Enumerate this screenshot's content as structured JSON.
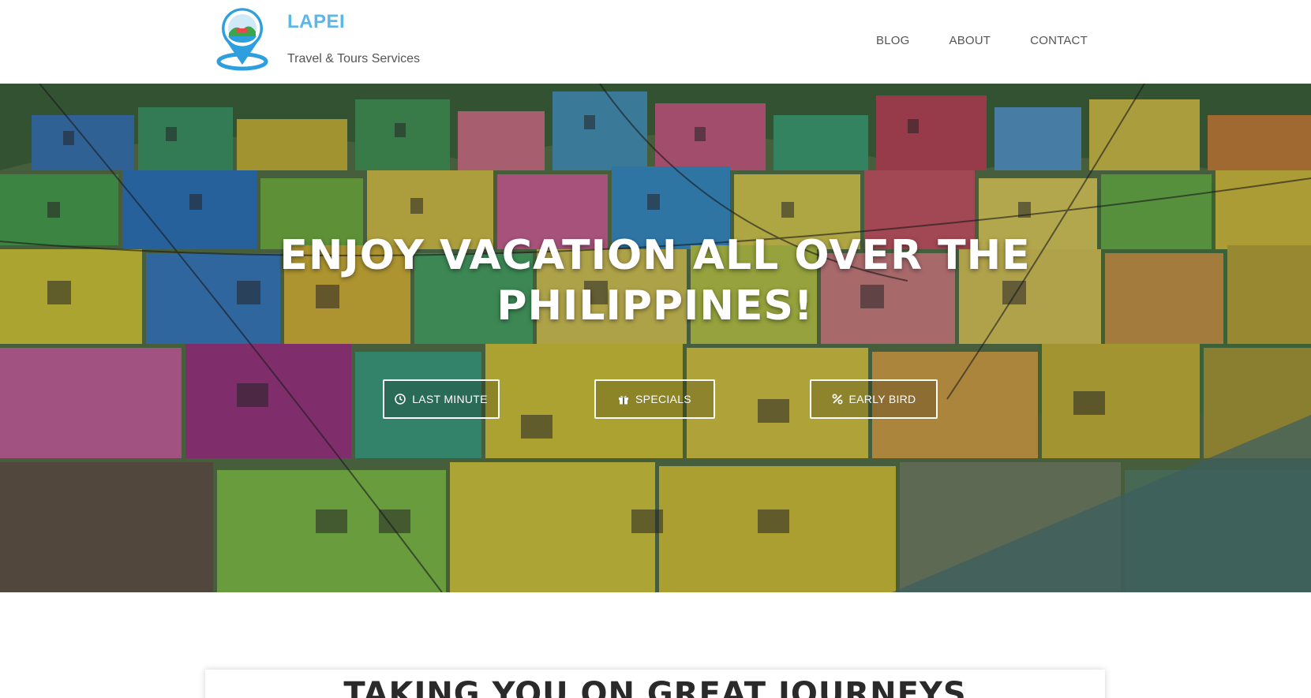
{
  "brand": {
    "name": "LAPEI",
    "tagline": "Travel & Tours Services",
    "accent_color": "#5bb8e6",
    "logo_icon": "map-pin-logo"
  },
  "nav": {
    "items": [
      {
        "label": "BLOG"
      },
      {
        "label": "ABOUT"
      },
      {
        "label": "CONTACT"
      }
    ]
  },
  "hero": {
    "title_line1": "ENJOY VACATION ALL OVER THE",
    "title_line2": "PHILIPPINES!",
    "background": "colorful-hillside-houses-photo",
    "buttons": [
      {
        "label": "LAST MINUTE",
        "icon": "clock-icon"
      },
      {
        "label": "SPECIALS",
        "icon": "gift-icon"
      },
      {
        "label": "EARLY BIRD",
        "icon": "percent-icon"
      }
    ]
  },
  "section": {
    "title": "TAKING YOU ON GREAT JOURNEYS"
  }
}
